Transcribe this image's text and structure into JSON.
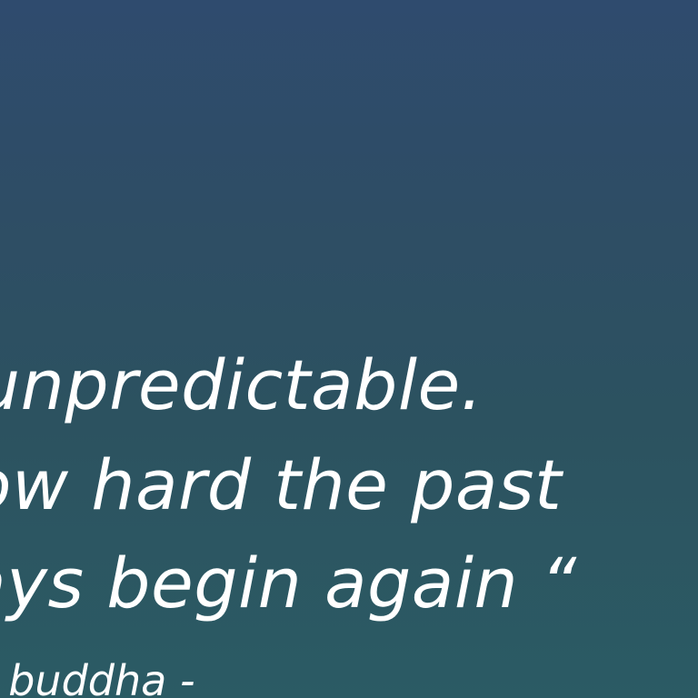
{
  "quote": {
    "lines": [
      "unpredictable.",
      "ow hard the past",
      "ays begin again “"
    ],
    "attribution": "- buddha -"
  },
  "colors": {
    "background_top": "#2f4b6e",
    "background_bottom": "#2b5b64",
    "text": "#ffffff"
  }
}
